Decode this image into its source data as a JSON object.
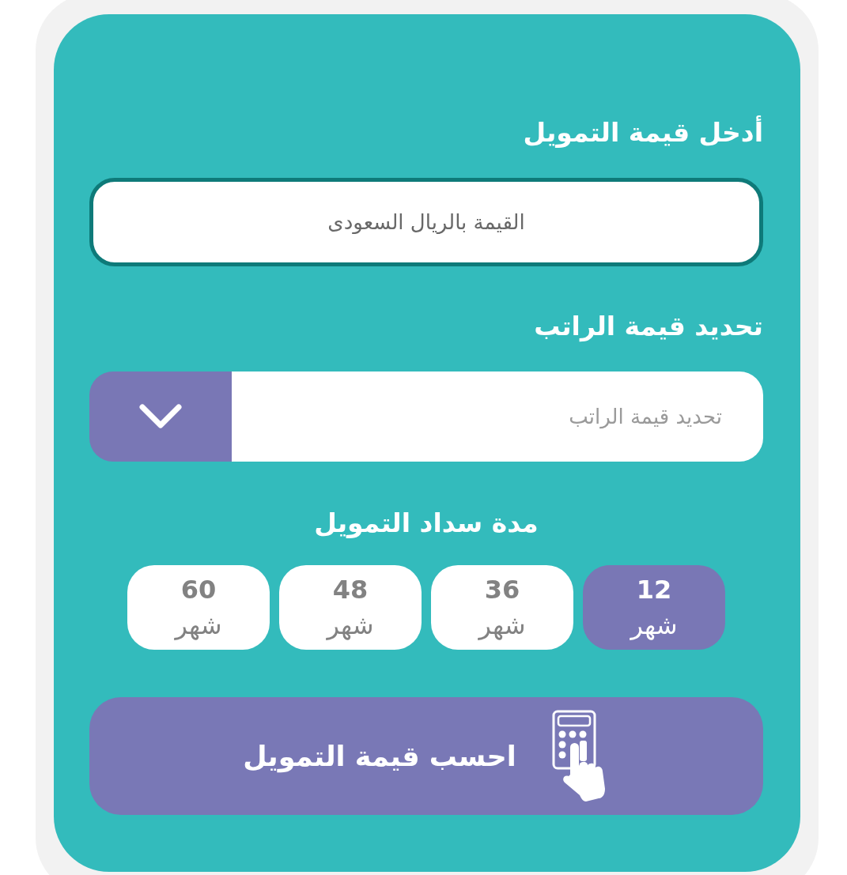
{
  "amount": {
    "title": "أدخل قيمة التمويل",
    "placeholder": "القيمة بالريال السعودى"
  },
  "salary": {
    "title": "تحديد قيمة الراتب",
    "placeholder": "تحديد قيمة الراتب"
  },
  "duration": {
    "title": "مدة سداد التمويل",
    "options": [
      {
        "value": "12",
        "unit": "شهر",
        "selected": true
      },
      {
        "value": "36",
        "unit": "شهر",
        "selected": false
      },
      {
        "value": "48",
        "unit": "شهر",
        "selected": false
      },
      {
        "value": "60",
        "unit": "شهر",
        "selected": false
      }
    ]
  },
  "calculate_button": {
    "label": "احسب قيمة التمويل"
  }
}
